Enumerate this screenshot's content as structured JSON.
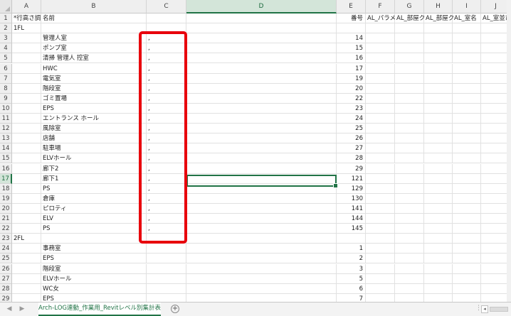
{
  "columns": [
    "A",
    "B",
    "C",
    "D",
    "E",
    "F",
    "G",
    "H",
    "I",
    "J"
  ],
  "selected_column": "D",
  "selected_row": 17,
  "rows": [
    {
      "n": 1,
      "A": "*行高さ調",
      "B": "名前",
      "E": "番号",
      "F": "AL_パラメ",
      "G": "AL_部屋ク",
      "H": "AL_部屋ク",
      "I": "AL_室名",
      "J": "AL_室並び"
    },
    {
      "n": 2,
      "A": "1FL"
    },
    {
      "n": 3,
      "B": "管理人室",
      "C": ",",
      "E": "14"
    },
    {
      "n": 4,
      "B": "ポンプ室",
      "C": ",",
      "E": "15"
    },
    {
      "n": 5,
      "B": "清掃 管理人 控室",
      "C": ",",
      "E": "16"
    },
    {
      "n": 6,
      "B": "HWC",
      "C": ",",
      "E": "17"
    },
    {
      "n": 7,
      "B": "電気室",
      "C": ",",
      "E": "19"
    },
    {
      "n": 8,
      "B": "階段室",
      "C": ",",
      "E": "20"
    },
    {
      "n": 9,
      "B": "ゴミ置場",
      "C": ",",
      "E": "22"
    },
    {
      "n": 10,
      "B": "EPS",
      "C": ",",
      "E": "23"
    },
    {
      "n": 11,
      "B": "エントランス ホール",
      "C": ",",
      "E": "24"
    },
    {
      "n": 12,
      "B": "風除室",
      "C": ",",
      "E": "25"
    },
    {
      "n": 13,
      "B": "店舗",
      "C": ",",
      "E": "26"
    },
    {
      "n": 14,
      "B": "駐車場",
      "C": ",",
      "E": "27"
    },
    {
      "n": 15,
      "B": "ELVホール",
      "C": ",",
      "E": "28"
    },
    {
      "n": 16,
      "B": "廊下2",
      "C": ",",
      "E": "29"
    },
    {
      "n": 17,
      "B": "廊下1",
      "C": ",",
      "E": "121"
    },
    {
      "n": 18,
      "B": "PS",
      "C": ",",
      "E": "129"
    },
    {
      "n": 19,
      "B": "倉庫",
      "C": ",",
      "E": "130"
    },
    {
      "n": 20,
      "B": "ピロティ",
      "C": ",",
      "E": "141"
    },
    {
      "n": 21,
      "B": "ELV",
      "C": ",",
      "E": "144"
    },
    {
      "n": 22,
      "B": "PS",
      "C": ",",
      "E": "145"
    },
    {
      "n": 23,
      "A": "2FL"
    },
    {
      "n": 24,
      "B": "事務室",
      "E": "1"
    },
    {
      "n": 25,
      "B": "EPS",
      "E": "2"
    },
    {
      "n": 26,
      "B": "階段室",
      "E": "3"
    },
    {
      "n": 27,
      "B": "ELVホール",
      "E": "5"
    },
    {
      "n": 28,
      "B": "WC女",
      "E": "6"
    },
    {
      "n": 29,
      "B": "EPS",
      "E": "7"
    }
  ],
  "sheet_tab": {
    "name": "Arch-LOG連動_作業用_Revitレベル別集計表"
  },
  "nav": {
    "prev": "◀",
    "next": "▶",
    "add": "+",
    "more": "⋮"
  },
  "colors": {
    "accent": "#217346",
    "highlight": "#e8000c"
  },
  "icons": {
    "add_sheet": "plus-circle-icon"
  }
}
